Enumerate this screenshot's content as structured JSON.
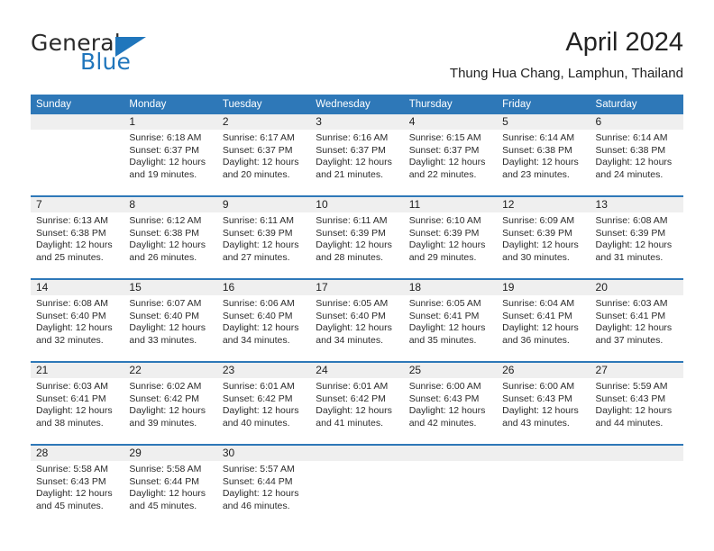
{
  "brand": {
    "word_one": "General",
    "word_two": "Blue",
    "accent_color": "#2076bc"
  },
  "header": {
    "title": "April 2024",
    "subtitle": "Thung Hua Chang, Lamphun, Thailand"
  },
  "calendar": {
    "header_bg": "#2e78b8",
    "daynum_band_bg": "#efefef",
    "weekday_names": [
      "Sunday",
      "Monday",
      "Tuesday",
      "Wednesday",
      "Thursday",
      "Friday",
      "Saturday"
    ],
    "labels": {
      "sunrise_prefix": "Sunrise:",
      "sunset_prefix": "Sunset:",
      "daylight_prefix": "Daylight:"
    },
    "weeks": [
      [
        {
          "day": "",
          "empty": true
        },
        {
          "day": "1",
          "sunrise": "Sunrise: 6:18 AM",
          "sunset": "Sunset: 6:37 PM",
          "daylight_line1": "Daylight: 12 hours",
          "daylight_line2": "and 19 minutes."
        },
        {
          "day": "2",
          "sunrise": "Sunrise: 6:17 AM",
          "sunset": "Sunset: 6:37 PM",
          "daylight_line1": "Daylight: 12 hours",
          "daylight_line2": "and 20 minutes."
        },
        {
          "day": "3",
          "sunrise": "Sunrise: 6:16 AM",
          "sunset": "Sunset: 6:37 PM",
          "daylight_line1": "Daylight: 12 hours",
          "daylight_line2": "and 21 minutes."
        },
        {
          "day": "4",
          "sunrise": "Sunrise: 6:15 AM",
          "sunset": "Sunset: 6:37 PM",
          "daylight_line1": "Daylight: 12 hours",
          "daylight_line2": "and 22 minutes."
        },
        {
          "day": "5",
          "sunrise": "Sunrise: 6:14 AM",
          "sunset": "Sunset: 6:38 PM",
          "daylight_line1": "Daylight: 12 hours",
          "daylight_line2": "and 23 minutes."
        },
        {
          "day": "6",
          "sunrise": "Sunrise: 6:14 AM",
          "sunset": "Sunset: 6:38 PM",
          "daylight_line1": "Daylight: 12 hours",
          "daylight_line2": "and 24 minutes."
        }
      ],
      [
        {
          "day": "7",
          "sunrise": "Sunrise: 6:13 AM",
          "sunset": "Sunset: 6:38 PM",
          "daylight_line1": "Daylight: 12 hours",
          "daylight_line2": "and 25 minutes."
        },
        {
          "day": "8",
          "sunrise": "Sunrise: 6:12 AM",
          "sunset": "Sunset: 6:38 PM",
          "daylight_line1": "Daylight: 12 hours",
          "daylight_line2": "and 26 minutes."
        },
        {
          "day": "9",
          "sunrise": "Sunrise: 6:11 AM",
          "sunset": "Sunset: 6:39 PM",
          "daylight_line1": "Daylight: 12 hours",
          "daylight_line2": "and 27 minutes."
        },
        {
          "day": "10",
          "sunrise": "Sunrise: 6:11 AM",
          "sunset": "Sunset: 6:39 PM",
          "daylight_line1": "Daylight: 12 hours",
          "daylight_line2": "and 28 minutes."
        },
        {
          "day": "11",
          "sunrise": "Sunrise: 6:10 AM",
          "sunset": "Sunset: 6:39 PM",
          "daylight_line1": "Daylight: 12 hours",
          "daylight_line2": "and 29 minutes."
        },
        {
          "day": "12",
          "sunrise": "Sunrise: 6:09 AM",
          "sunset": "Sunset: 6:39 PM",
          "daylight_line1": "Daylight: 12 hours",
          "daylight_line2": "and 30 minutes."
        },
        {
          "day": "13",
          "sunrise": "Sunrise: 6:08 AM",
          "sunset": "Sunset: 6:39 PM",
          "daylight_line1": "Daylight: 12 hours",
          "daylight_line2": "and 31 minutes."
        }
      ],
      [
        {
          "day": "14",
          "sunrise": "Sunrise: 6:08 AM",
          "sunset": "Sunset: 6:40 PM",
          "daylight_line1": "Daylight: 12 hours",
          "daylight_line2": "and 32 minutes."
        },
        {
          "day": "15",
          "sunrise": "Sunrise: 6:07 AM",
          "sunset": "Sunset: 6:40 PM",
          "daylight_line1": "Daylight: 12 hours",
          "daylight_line2": "and 33 minutes."
        },
        {
          "day": "16",
          "sunrise": "Sunrise: 6:06 AM",
          "sunset": "Sunset: 6:40 PM",
          "daylight_line1": "Daylight: 12 hours",
          "daylight_line2": "and 34 minutes."
        },
        {
          "day": "17",
          "sunrise": "Sunrise: 6:05 AM",
          "sunset": "Sunset: 6:40 PM",
          "daylight_line1": "Daylight: 12 hours",
          "daylight_line2": "and 34 minutes."
        },
        {
          "day": "18",
          "sunrise": "Sunrise: 6:05 AM",
          "sunset": "Sunset: 6:41 PM",
          "daylight_line1": "Daylight: 12 hours",
          "daylight_line2": "and 35 minutes."
        },
        {
          "day": "19",
          "sunrise": "Sunrise: 6:04 AM",
          "sunset": "Sunset: 6:41 PM",
          "daylight_line1": "Daylight: 12 hours",
          "daylight_line2": "and 36 minutes."
        },
        {
          "day": "20",
          "sunrise": "Sunrise: 6:03 AM",
          "sunset": "Sunset: 6:41 PM",
          "daylight_line1": "Daylight: 12 hours",
          "daylight_line2": "and 37 minutes."
        }
      ],
      [
        {
          "day": "21",
          "sunrise": "Sunrise: 6:03 AM",
          "sunset": "Sunset: 6:41 PM",
          "daylight_line1": "Daylight: 12 hours",
          "daylight_line2": "and 38 minutes."
        },
        {
          "day": "22",
          "sunrise": "Sunrise: 6:02 AM",
          "sunset": "Sunset: 6:42 PM",
          "daylight_line1": "Daylight: 12 hours",
          "daylight_line2": "and 39 minutes."
        },
        {
          "day": "23",
          "sunrise": "Sunrise: 6:01 AM",
          "sunset": "Sunset: 6:42 PM",
          "daylight_line1": "Daylight: 12 hours",
          "daylight_line2": "and 40 minutes."
        },
        {
          "day": "24",
          "sunrise": "Sunrise: 6:01 AM",
          "sunset": "Sunset: 6:42 PM",
          "daylight_line1": "Daylight: 12 hours",
          "daylight_line2": "and 41 minutes."
        },
        {
          "day": "25",
          "sunrise": "Sunrise: 6:00 AM",
          "sunset": "Sunset: 6:43 PM",
          "daylight_line1": "Daylight: 12 hours",
          "daylight_line2": "and 42 minutes."
        },
        {
          "day": "26",
          "sunrise": "Sunrise: 6:00 AM",
          "sunset": "Sunset: 6:43 PM",
          "daylight_line1": "Daylight: 12 hours",
          "daylight_line2": "and 43 minutes."
        },
        {
          "day": "27",
          "sunrise": "Sunrise: 5:59 AM",
          "sunset": "Sunset: 6:43 PM",
          "daylight_line1": "Daylight: 12 hours",
          "daylight_line2": "and 44 minutes."
        }
      ],
      [
        {
          "day": "28",
          "sunrise": "Sunrise: 5:58 AM",
          "sunset": "Sunset: 6:43 PM",
          "daylight_line1": "Daylight: 12 hours",
          "daylight_line2": "and 45 minutes."
        },
        {
          "day": "29",
          "sunrise": "Sunrise: 5:58 AM",
          "sunset": "Sunset: 6:44 PM",
          "daylight_line1": "Daylight: 12 hours",
          "daylight_line2": "and 45 minutes."
        },
        {
          "day": "30",
          "sunrise": "Sunrise: 5:57 AM",
          "sunset": "Sunset: 6:44 PM",
          "daylight_line1": "Daylight: 12 hours",
          "daylight_line2": "and 46 minutes."
        },
        {
          "day": "",
          "empty": true
        },
        {
          "day": "",
          "empty": true
        },
        {
          "day": "",
          "empty": true
        },
        {
          "day": "",
          "empty": true
        }
      ]
    ]
  }
}
